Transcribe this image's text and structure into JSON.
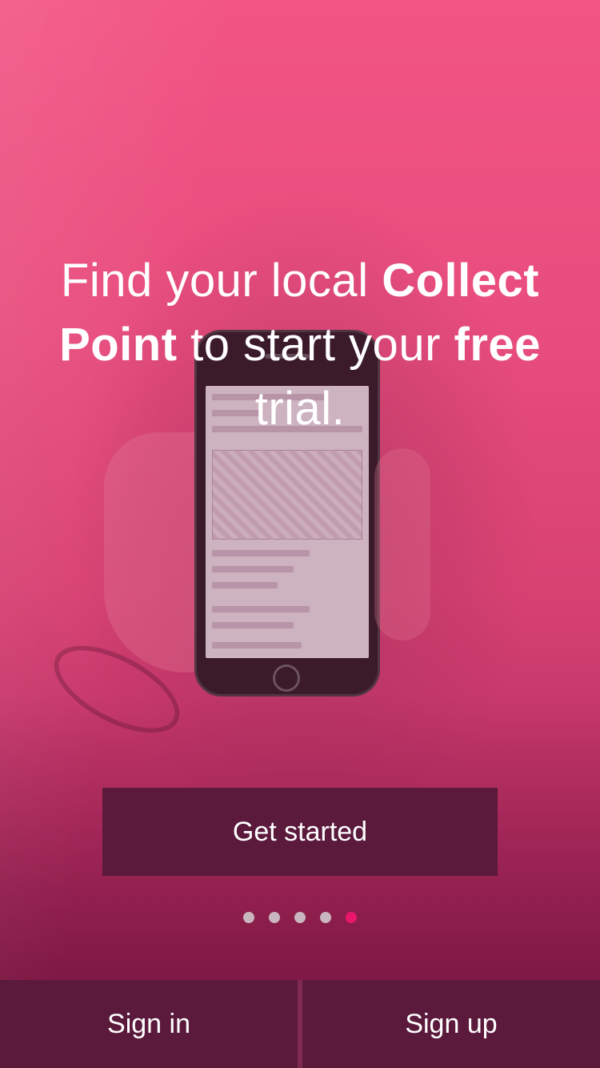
{
  "headline": {
    "part1": "Find your local ",
    "bold1": "Collect Point",
    "part2": " to start your ",
    "bold2": "free",
    "part3": " trial."
  },
  "cta": {
    "label": "Get started"
  },
  "pagination": {
    "total": 5,
    "active_index": 4
  },
  "bottom_bar": {
    "sign_in_label": "Sign in",
    "sign_up_label": "Sign up"
  },
  "colors": {
    "brand_pink": "#e84d7d",
    "button_bg": "#5b1a3c",
    "dot_active": "#e8176b",
    "dot_inactive": "#c9b6bf"
  }
}
